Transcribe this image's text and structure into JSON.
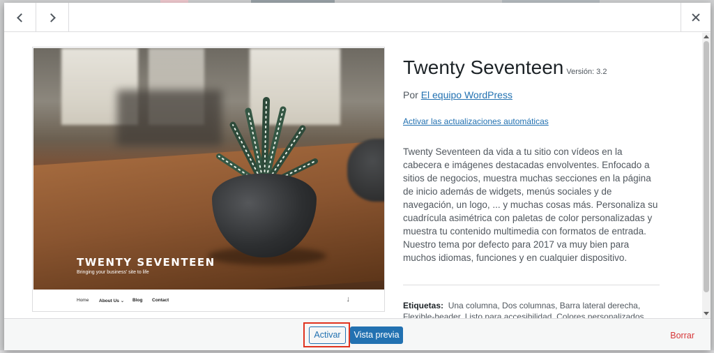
{
  "header": {
    "prev_label": "",
    "next_label": "",
    "close_label": ""
  },
  "screenshot": {
    "site_title": "TWENTY SEVENTEEN",
    "site_tagline": "Bringing your business' site to life",
    "nav_items": [
      "Home",
      "About Us",
      "Blog",
      "Contact"
    ],
    "nav_dropdown_glyph": "⌄",
    "scroll_down_glyph": "↓"
  },
  "theme": {
    "name": "Twenty Seventeen",
    "version": "Versión: 3.2",
    "author_prefix": "Por",
    "author_link": "El equipo WordPress",
    "auto_update_link": "Activar las actualizaciones automáticas",
    "description": "Twenty Seventeen da vida a tu sitio con vídeos en la cabecera e imágenes destacadas envolventes. Enfocado a sitios de negocios, muestra muchas secciones en la página de inicio además de widgets, menús sociales y de navegación, un logo, ... y muchas cosas más. Personaliza su cuadrícula asimétrica con paletas de color personalizadas y muestra tu contenido multimedia con formatos de entrada. Nuestro tema por defecto para 2017 va muy bien para muchos idiomas, funciones y en cualquier dispositivo.",
    "tags_label": "Etiquetas:",
    "tags_text": "Una columna, Dos columnas, Barra lateral derecha, Flexible-header, Listo para accesibilidad, Colores personalizados, Cabecera"
  },
  "footer": {
    "activate_label": "Activar",
    "preview_label": "Vista previa",
    "delete_label": "Borrar"
  },
  "colors": {
    "primary": "#2271b1",
    "danger": "#d63638",
    "highlight": "#e0331f"
  }
}
